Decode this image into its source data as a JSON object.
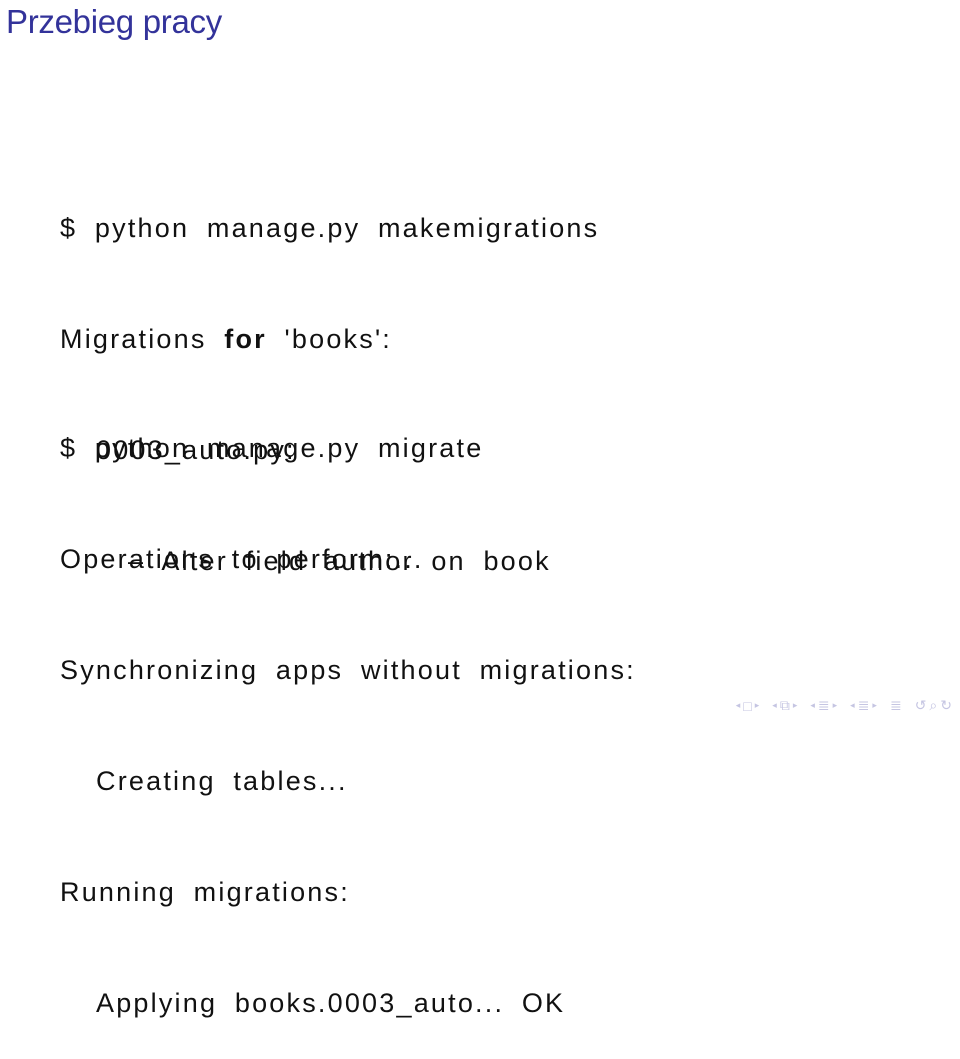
{
  "frame": {
    "title": "Przebieg pracy",
    "title_color": "#33339a"
  },
  "block1": {
    "lines": [
      {
        "text": "$ python manage.py makemigrations"
      },
      {
        "pre": "Migrations ",
        "keyword": "for",
        "post": " 'books':"
      },
      {
        "text": "0003_auto.py:"
      },
      {
        "text": "– Alter field author on book"
      }
    ]
  },
  "block2": {
    "lines": [
      {
        "text": "$ python manage.py migrate"
      },
      {
        "text": "Operations to perform:..."
      },
      {
        "text": "Synchronizing apps without migrations:"
      },
      {
        "text": "Creating tables..."
      },
      {
        "text": "Running migrations:"
      },
      {
        "text": "Applying books.0003_auto... OK"
      }
    ]
  },
  "navigation": {
    "icons": [
      "prev-frame",
      "frame",
      "next-frame",
      "prev-subsection",
      "subsection",
      "next-subsection",
      "prev-section",
      "section",
      "next-section",
      "prev-document",
      "document",
      "next-document",
      "appendix",
      "back",
      "search",
      "forward"
    ],
    "glyphs": {
      "left": "◂",
      "right": "▸",
      "frame": "□",
      "subsection": "⧉",
      "section": "≣",
      "back": "↺",
      "search": "⌕",
      "forward": "↻"
    }
  }
}
